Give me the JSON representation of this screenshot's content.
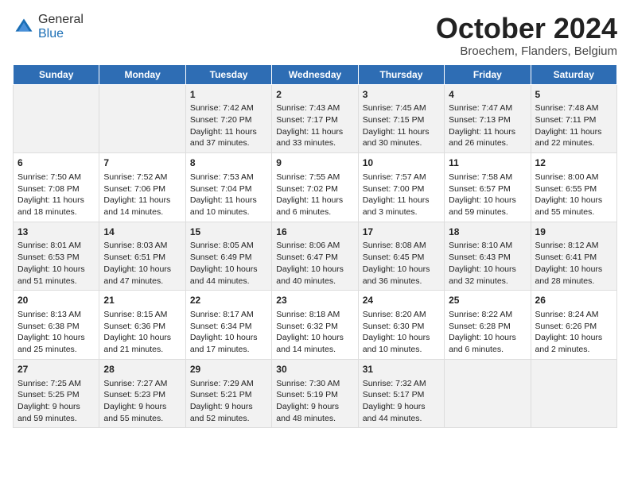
{
  "logo": {
    "general": "General",
    "blue": "Blue"
  },
  "title": {
    "month_year": "October 2024",
    "location": "Broechem, Flanders, Belgium"
  },
  "weekdays": [
    "Sunday",
    "Monday",
    "Tuesday",
    "Wednesday",
    "Thursday",
    "Friday",
    "Saturday"
  ],
  "weeks": [
    [
      {
        "day": "",
        "info": ""
      },
      {
        "day": "",
        "info": ""
      },
      {
        "day": "1",
        "info": "Sunrise: 7:42 AM\nSunset: 7:20 PM\nDaylight: 11 hours and 37 minutes."
      },
      {
        "day": "2",
        "info": "Sunrise: 7:43 AM\nSunset: 7:17 PM\nDaylight: 11 hours and 33 minutes."
      },
      {
        "day": "3",
        "info": "Sunrise: 7:45 AM\nSunset: 7:15 PM\nDaylight: 11 hours and 30 minutes."
      },
      {
        "day": "4",
        "info": "Sunrise: 7:47 AM\nSunset: 7:13 PM\nDaylight: 11 hours and 26 minutes."
      },
      {
        "day": "5",
        "info": "Sunrise: 7:48 AM\nSunset: 7:11 PM\nDaylight: 11 hours and 22 minutes."
      }
    ],
    [
      {
        "day": "6",
        "info": "Sunrise: 7:50 AM\nSunset: 7:08 PM\nDaylight: 11 hours and 18 minutes."
      },
      {
        "day": "7",
        "info": "Sunrise: 7:52 AM\nSunset: 7:06 PM\nDaylight: 11 hours and 14 minutes."
      },
      {
        "day": "8",
        "info": "Sunrise: 7:53 AM\nSunset: 7:04 PM\nDaylight: 11 hours and 10 minutes."
      },
      {
        "day": "9",
        "info": "Sunrise: 7:55 AM\nSunset: 7:02 PM\nDaylight: 11 hours and 6 minutes."
      },
      {
        "day": "10",
        "info": "Sunrise: 7:57 AM\nSunset: 7:00 PM\nDaylight: 11 hours and 3 minutes."
      },
      {
        "day": "11",
        "info": "Sunrise: 7:58 AM\nSunset: 6:57 PM\nDaylight: 10 hours and 59 minutes."
      },
      {
        "day": "12",
        "info": "Sunrise: 8:00 AM\nSunset: 6:55 PM\nDaylight: 10 hours and 55 minutes."
      }
    ],
    [
      {
        "day": "13",
        "info": "Sunrise: 8:01 AM\nSunset: 6:53 PM\nDaylight: 10 hours and 51 minutes."
      },
      {
        "day": "14",
        "info": "Sunrise: 8:03 AM\nSunset: 6:51 PM\nDaylight: 10 hours and 47 minutes."
      },
      {
        "day": "15",
        "info": "Sunrise: 8:05 AM\nSunset: 6:49 PM\nDaylight: 10 hours and 44 minutes."
      },
      {
        "day": "16",
        "info": "Sunrise: 8:06 AM\nSunset: 6:47 PM\nDaylight: 10 hours and 40 minutes."
      },
      {
        "day": "17",
        "info": "Sunrise: 8:08 AM\nSunset: 6:45 PM\nDaylight: 10 hours and 36 minutes."
      },
      {
        "day": "18",
        "info": "Sunrise: 8:10 AM\nSunset: 6:43 PM\nDaylight: 10 hours and 32 minutes."
      },
      {
        "day": "19",
        "info": "Sunrise: 8:12 AM\nSunset: 6:41 PM\nDaylight: 10 hours and 28 minutes."
      }
    ],
    [
      {
        "day": "20",
        "info": "Sunrise: 8:13 AM\nSunset: 6:38 PM\nDaylight: 10 hours and 25 minutes."
      },
      {
        "day": "21",
        "info": "Sunrise: 8:15 AM\nSunset: 6:36 PM\nDaylight: 10 hours and 21 minutes."
      },
      {
        "day": "22",
        "info": "Sunrise: 8:17 AM\nSunset: 6:34 PM\nDaylight: 10 hours and 17 minutes."
      },
      {
        "day": "23",
        "info": "Sunrise: 8:18 AM\nSunset: 6:32 PM\nDaylight: 10 hours and 14 minutes."
      },
      {
        "day": "24",
        "info": "Sunrise: 8:20 AM\nSunset: 6:30 PM\nDaylight: 10 hours and 10 minutes."
      },
      {
        "day": "25",
        "info": "Sunrise: 8:22 AM\nSunset: 6:28 PM\nDaylight: 10 hours and 6 minutes."
      },
      {
        "day": "26",
        "info": "Sunrise: 8:24 AM\nSunset: 6:26 PM\nDaylight: 10 hours and 2 minutes."
      }
    ],
    [
      {
        "day": "27",
        "info": "Sunrise: 7:25 AM\nSunset: 5:25 PM\nDaylight: 9 hours and 59 minutes."
      },
      {
        "day": "28",
        "info": "Sunrise: 7:27 AM\nSunset: 5:23 PM\nDaylight: 9 hours and 55 minutes."
      },
      {
        "day": "29",
        "info": "Sunrise: 7:29 AM\nSunset: 5:21 PM\nDaylight: 9 hours and 52 minutes."
      },
      {
        "day": "30",
        "info": "Sunrise: 7:30 AM\nSunset: 5:19 PM\nDaylight: 9 hours and 48 minutes."
      },
      {
        "day": "31",
        "info": "Sunrise: 7:32 AM\nSunset: 5:17 PM\nDaylight: 9 hours and 44 minutes."
      },
      {
        "day": "",
        "info": ""
      },
      {
        "day": "",
        "info": ""
      }
    ]
  ]
}
